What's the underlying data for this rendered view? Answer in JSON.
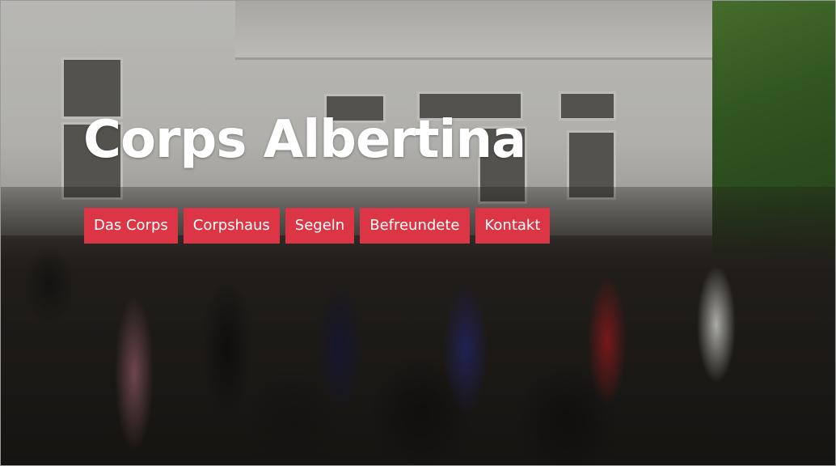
{
  "site": {
    "title": "Corps Albertina"
  },
  "nav": {
    "items": [
      {
        "label": "Das Corps"
      },
      {
        "label": "Corpshaus"
      },
      {
        "label": "Segeln"
      },
      {
        "label": "Befreundete"
      },
      {
        "label": "Kontakt"
      }
    ]
  },
  "colors": {
    "nav_background": "#dc3545",
    "nav_text": "#ffffff",
    "title_text": "#ffffff"
  },
  "hero": {
    "image": "group-photo-in-front-of-white-villa"
  }
}
